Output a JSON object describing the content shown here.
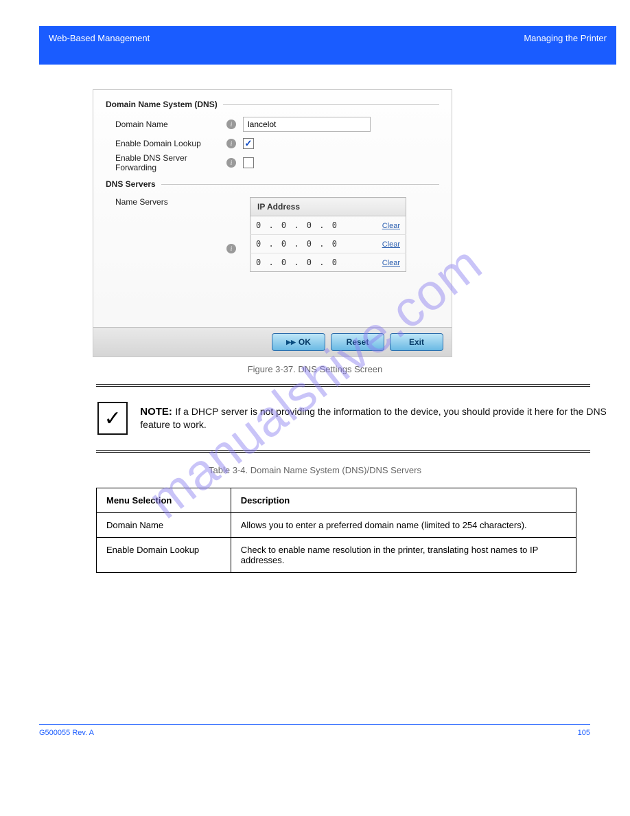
{
  "header": {
    "left": "Web-Based Management",
    "right": "Managing the Printer"
  },
  "panel": {
    "section1_title": "Domain Name System (DNS)",
    "domain_name_label": "Domain Name",
    "domain_name_value": "lancelot",
    "enable_lookup_label": "Enable Domain Lookup",
    "enable_lookup_checked": true,
    "enable_forwarding_label": "Enable DNS Server Forwarding",
    "enable_forwarding_checked": false,
    "section2_title": "DNS Servers",
    "name_servers_label": "Name Servers",
    "ip_header": "IP Address",
    "ip_rows": [
      {
        "ip": "0 . 0 . 0 . 0",
        "clear": "Clear"
      },
      {
        "ip": "0 . 0 . 0 . 0",
        "clear": "Clear"
      },
      {
        "ip": "0 . 0 . 0 . 0",
        "clear": "Clear"
      }
    ],
    "ok_label": "OK",
    "reset_label": "Reset",
    "exit_label": "Exit"
  },
  "figure_caption": "Figure 3-37. DNS Settings Screen",
  "note": {
    "label": "NOTE:",
    "text": "If a DHCP server is not providing the information to the device, you should provide it here for the DNS feature to work."
  },
  "table": {
    "caption": "Table 3-4. Domain Name System (DNS)/DNS Servers",
    "columns": [
      "Menu Selection",
      "Description"
    ],
    "rows": [
      {
        "c0": "Domain Name",
        "c1": "Allows you to enter a preferred domain name (limited to 254 characters)."
      },
      {
        "c0": "Enable Domain Lookup",
        "c1": "Check to enable name resolution in the printer, translating host names to IP addresses."
      }
    ]
  },
  "footer": {
    "left": "G500055 Rev. A",
    "right": "105"
  },
  "watermark": "manualshive.com"
}
